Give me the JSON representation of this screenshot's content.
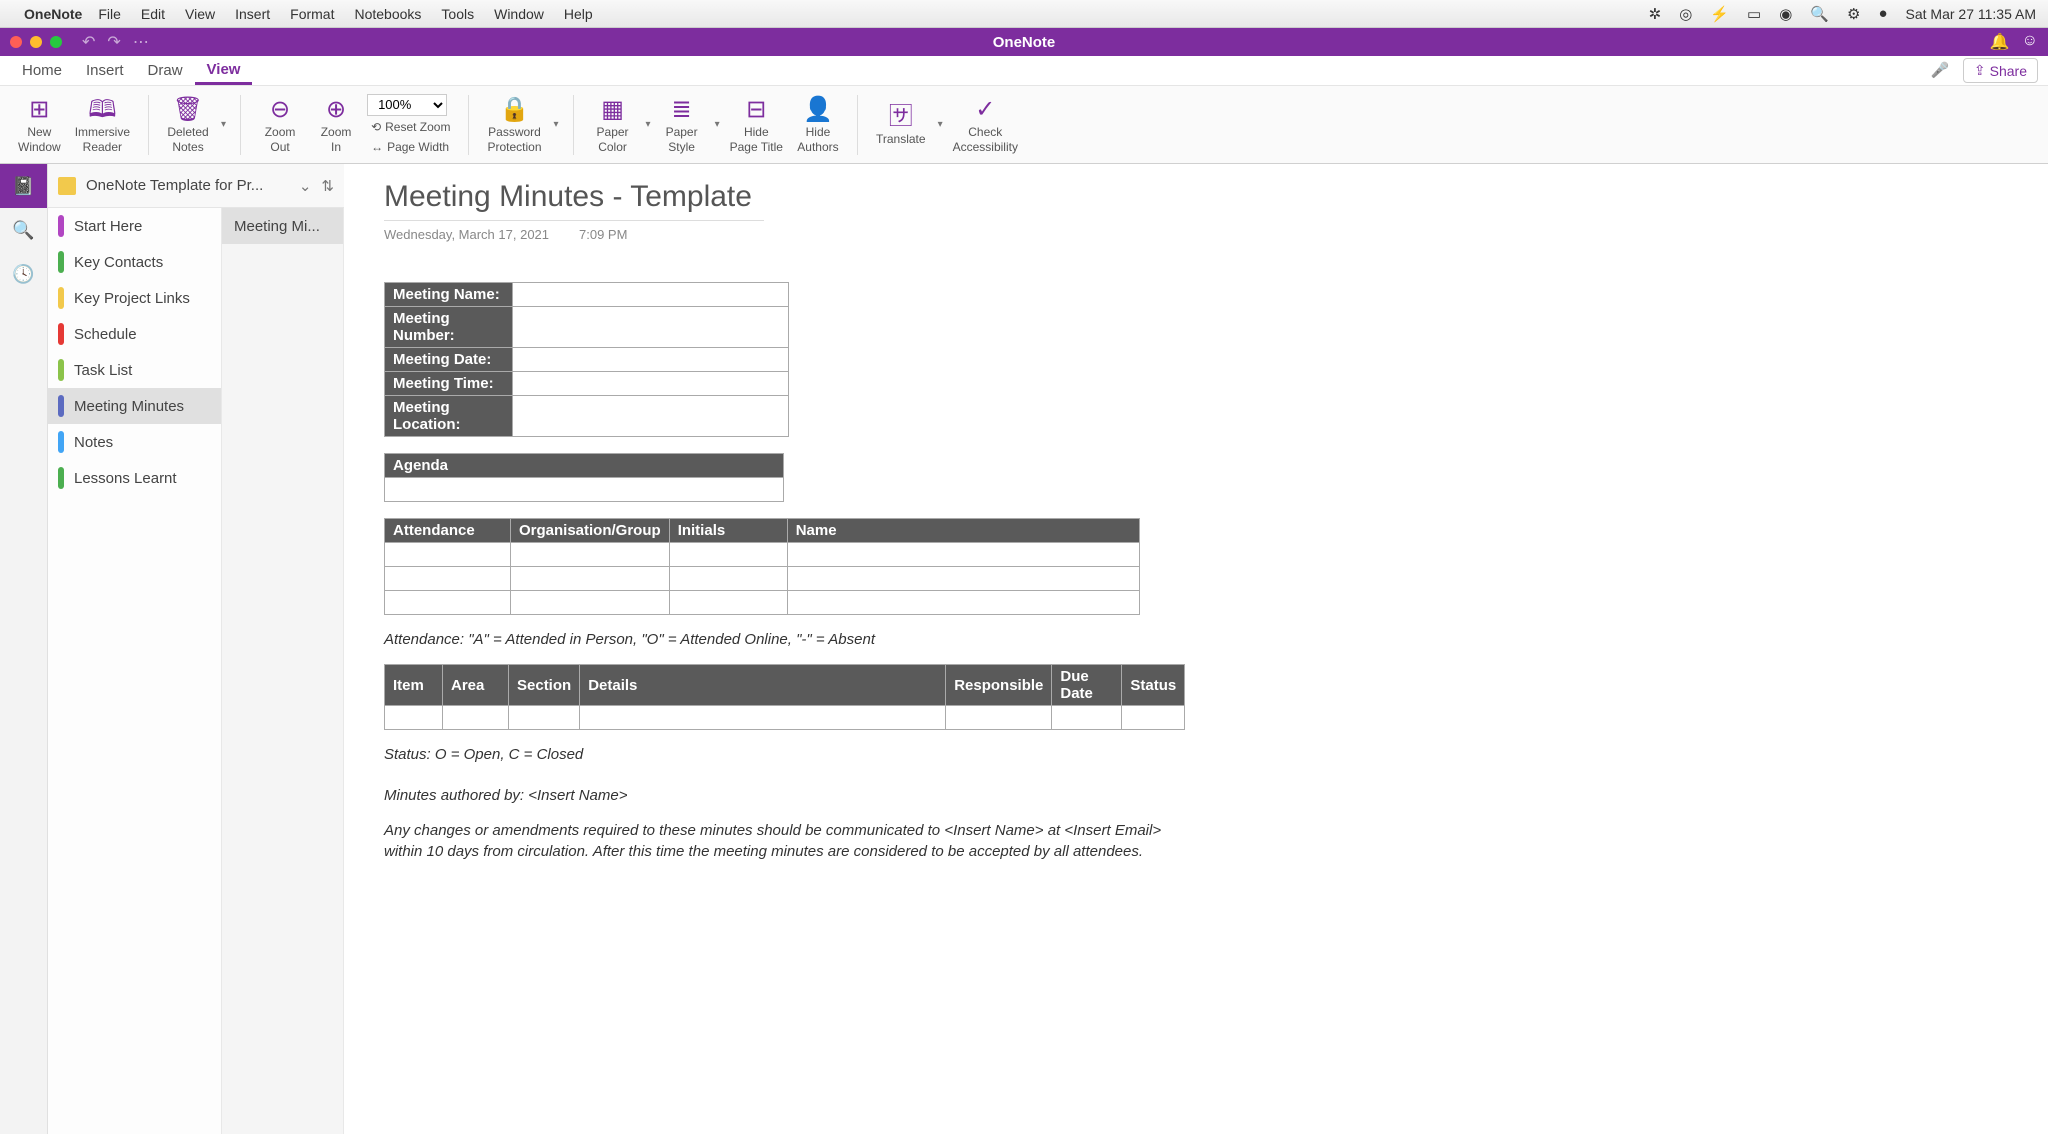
{
  "menubar": {
    "app": "OneNote",
    "items": [
      "File",
      "Edit",
      "View",
      "Insert",
      "Format",
      "Notebooks",
      "Tools",
      "Window",
      "Help"
    ],
    "datetime": "Sat Mar 27  11:35 AM"
  },
  "titlebar": {
    "title": "OneNote"
  },
  "tabs": {
    "items": [
      "Home",
      "Insert",
      "Draw",
      "View"
    ],
    "active": "View",
    "share": "Share"
  },
  "ribbon": {
    "new_window": "New\nWindow",
    "immersive": "Immersive\nReader",
    "deleted": "Deleted\nNotes",
    "zoom_out": "Zoom\nOut",
    "zoom_in": "Zoom\nIn",
    "zoom_val": "100%",
    "reset_zoom": "Reset Zoom",
    "page_width": "Page Width",
    "password": "Password\nProtection",
    "paper_color": "Paper\nColor",
    "paper_style": "Paper\nStyle",
    "hide_title": "Hide\nPage Title",
    "hide_authors": "Hide\nAuthors",
    "translate": "Translate",
    "accessibility": "Check\nAccessibility"
  },
  "notebook": {
    "name": "OneNote Template for Pr..."
  },
  "sections": [
    {
      "label": "Start Here",
      "color": "#b146c2"
    },
    {
      "label": "Key Contacts",
      "color": "#4caf50"
    },
    {
      "label": "Key Project Links",
      "color": "#f2c94c"
    },
    {
      "label": "Schedule",
      "color": "#e53935"
    },
    {
      "label": "Task List",
      "color": "#8bc34a"
    },
    {
      "label": "Meeting Minutes",
      "color": "#5c6bc0",
      "active": true
    },
    {
      "label": "Notes",
      "color": "#42a5f5"
    },
    {
      "label": "Lessons Learnt",
      "color": "#4caf50"
    }
  ],
  "pages": [
    {
      "label": "Meeting Mi...",
      "active": true
    }
  ],
  "page": {
    "title": "Meeting Minutes - Template",
    "date": "Wednesday, March 17, 2021",
    "time": "7:09 PM",
    "meeting_fields": [
      "Meeting Name:",
      "Meeting Number:",
      "Meeting Date:",
      "Meeting Time:",
      "Meeting Location:"
    ],
    "agenda_header": "Agenda",
    "attendance_headers": [
      "Attendance",
      "Organisation/Group",
      "Initials",
      "Name"
    ],
    "attendance_legend": "Attendance: \"A\" = Attended in Person, \"O\" = Attended Online, \"-\" = Absent",
    "items_headers": [
      "Item",
      "Area",
      "Section",
      "Details",
      "Responsible",
      "Due Date",
      "Status"
    ],
    "status_legend": "Status: O = Open, C = Closed",
    "authored_by": "Minutes authored by: <Insert Name>",
    "disclaimer": "Any changes or amendments required to these minutes should be communicated to <Insert Name> at <Insert Email> within 10 days from circulation. After this time the meeting minutes are considered to be accepted by all attendees."
  }
}
